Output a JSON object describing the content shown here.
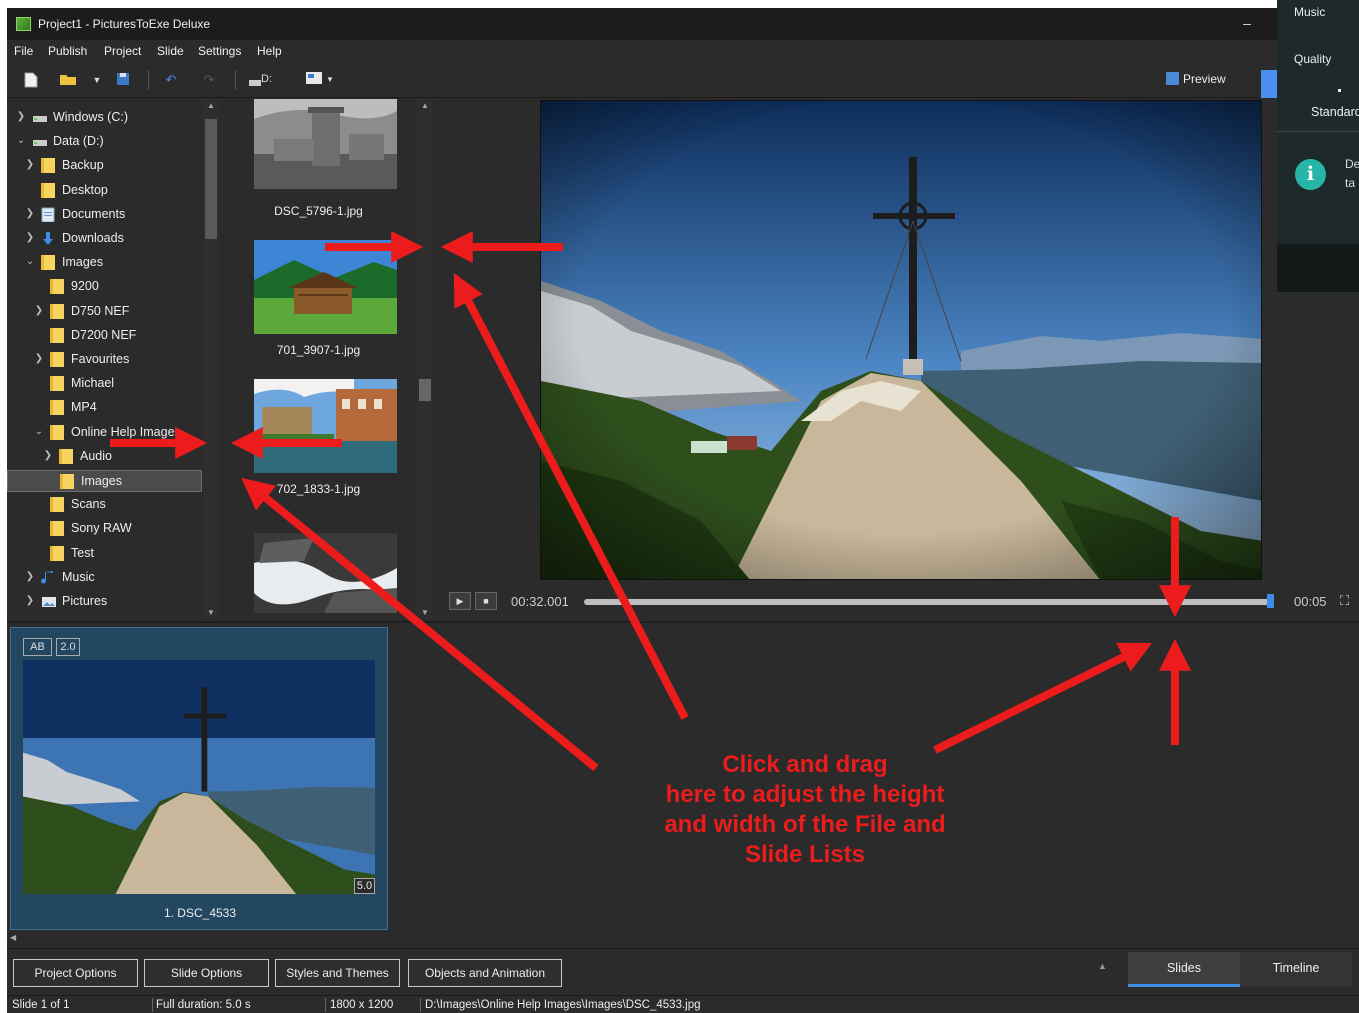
{
  "window": {
    "title": "Project1 - PicturesToExe Deluxe",
    "minimize": "–"
  },
  "menu": [
    "File",
    "Publish",
    "Project",
    "Slide",
    "Settings",
    "Help"
  ],
  "toolbar": {
    "drive_label": "D:",
    "preview_label": "Preview"
  },
  "tree": [
    {
      "label": "Windows (C:)",
      "icon": "drive-icon",
      "depth": 0,
      "expander": "collapsed"
    },
    {
      "label": "Data (D:)",
      "icon": "drive-icon",
      "depth": 0,
      "expander": "expanded"
    },
    {
      "label": "Backup",
      "icon": "folder-icon",
      "depth": 1,
      "expander": "collapsed"
    },
    {
      "label": "Desktop",
      "icon": "folder-icon",
      "depth": 1,
      "expander": "none"
    },
    {
      "label": "Documents",
      "icon": "documents-icon",
      "depth": 1,
      "expander": "collapsed"
    },
    {
      "label": "Downloads",
      "icon": "downloads-icon",
      "depth": 1,
      "expander": "collapsed"
    },
    {
      "label": "Images",
      "icon": "folder-icon",
      "depth": 1,
      "expander": "expanded"
    },
    {
      "label": "9200",
      "icon": "folder-icon",
      "depth": 2,
      "expander": "none"
    },
    {
      "label": "D750 NEF",
      "icon": "folder-icon",
      "depth": 2,
      "expander": "collapsed"
    },
    {
      "label": "D7200 NEF",
      "icon": "folder-icon",
      "depth": 2,
      "expander": "none"
    },
    {
      "label": "Favourites",
      "icon": "folder-icon",
      "depth": 2,
      "expander": "collapsed"
    },
    {
      "label": "Michael",
      "icon": "folder-icon",
      "depth": 2,
      "expander": "none"
    },
    {
      "label": "MP4",
      "icon": "folder-icon",
      "depth": 2,
      "expander": "none"
    },
    {
      "label": "Online Help Images",
      "icon": "folder-icon",
      "depth": 2,
      "expander": "expanded"
    },
    {
      "label": "Audio",
      "icon": "folder-icon",
      "depth": 3,
      "expander": "collapsed"
    },
    {
      "label": "Images",
      "icon": "folder-icon",
      "depth": 3,
      "expander": "none",
      "selected": true
    },
    {
      "label": "Scans",
      "icon": "folder-icon",
      "depth": 2,
      "expander": "none"
    },
    {
      "label": "Sony RAW",
      "icon": "folder-icon",
      "depth": 2,
      "expander": "none"
    },
    {
      "label": "Test",
      "icon": "folder-icon",
      "depth": 2,
      "expander": "none"
    },
    {
      "label": "Music",
      "icon": "music-icon",
      "depth": 1,
      "expander": "collapsed"
    },
    {
      "label": "Pictures",
      "icon": "pictures-icon",
      "depth": 1,
      "expander": "collapsed"
    }
  ],
  "files": [
    {
      "name": "DSC_5796-1.jpg",
      "scene": "castle-bw"
    },
    {
      "name": "701_3907-1.jpg",
      "scene": "hut-meadow"
    },
    {
      "name": "702_1833-1.jpg",
      "scene": "castle-lake"
    },
    {
      "name": "",
      "scene": "waterfall"
    }
  ],
  "player": {
    "current_time": "00:32.001",
    "end_time": "00:05",
    "progress": 1.0
  },
  "side_panel": {
    "music": "Music",
    "quality": "Quality",
    "standard": "Standard",
    "info_text": "De\nta"
  },
  "slide": {
    "badge_ab": "AB",
    "badge_speed": "2.0",
    "duration": "5.0",
    "name": "1. DSC_4533"
  },
  "buttons": {
    "project_options": "Project Options",
    "slide_options": "Slide Options",
    "styles_themes": "Styles and Themes",
    "objects_animation": "Objects and Animation"
  },
  "tabs": {
    "slides": "Slides",
    "timeline": "Timeline"
  },
  "status": {
    "slide_count": "Slide 1 of 1",
    "duration": "Full duration: 5.0 s",
    "resolution": "1800 x 1200",
    "path": "D:\\Images\\Online Help Images\\Images\\DSC_4533.jpg"
  },
  "annotation": {
    "lines": [
      "Click and drag",
      "here to adjust the height",
      "and width of the File and",
      "Slide Lists"
    ],
    "color": "#ec1c1c"
  },
  "colors": {
    "accent": "#3d8de8",
    "panel": "#2b2b2b",
    "selection": "#234761"
  }
}
